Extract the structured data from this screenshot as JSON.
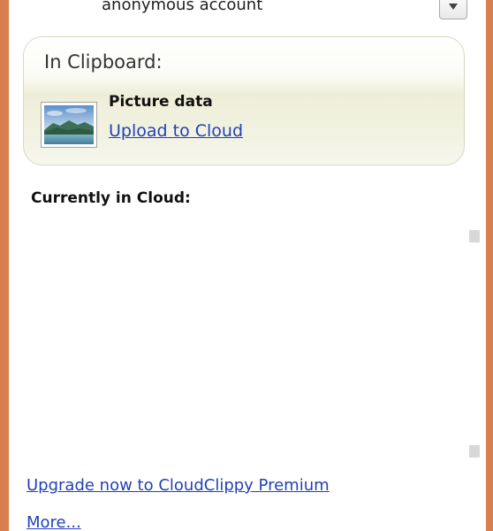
{
  "account": {
    "label": "anonymous account",
    "dropdown_icon": "chevron-down-icon"
  },
  "clipboard": {
    "title": "In Clipboard:",
    "item": {
      "thumbnail_icon": "picture-thumbnail",
      "label": "Picture data",
      "action_link": "Upload to Cloud"
    }
  },
  "cloud": {
    "heading": "Currently in Cloud:",
    "items": []
  },
  "footer": {
    "upgrade_link": "Upgrade now to CloudClippy Premium",
    "more_link": "More..."
  },
  "colors": {
    "link": "#2241b8",
    "frame": "#df8c5e"
  }
}
